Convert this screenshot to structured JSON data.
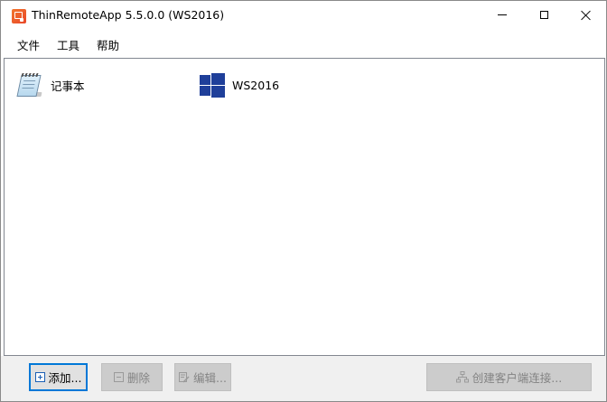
{
  "window": {
    "title": "ThinRemoteApp  5.5.0.0 (WS2016)",
    "icon": "app-logo-icon"
  },
  "menu": {
    "items": [
      {
        "label": "文件"
      },
      {
        "label": "工具"
      },
      {
        "label": "帮助"
      }
    ]
  },
  "apps": [
    {
      "label": "记事本",
      "icon": "notepad-icon"
    },
    {
      "label": "WS2016",
      "icon": "windows-logo-icon"
    }
  ],
  "buttons": {
    "add": {
      "label": "添加...",
      "icon": "add-icon",
      "state": "enabled"
    },
    "delete": {
      "label": "删除",
      "icon": "delete-icon",
      "state": "disabled"
    },
    "edit": {
      "label": "编辑...",
      "icon": "edit-icon",
      "state": "disabled"
    },
    "create_client": {
      "label": "创建客户端连接...",
      "icon": "network-icon",
      "state": "disabled"
    }
  },
  "colors": {
    "accent": "#0078d7",
    "windows_logo": "#1f3f9a",
    "app_icon": "#e8472a"
  }
}
